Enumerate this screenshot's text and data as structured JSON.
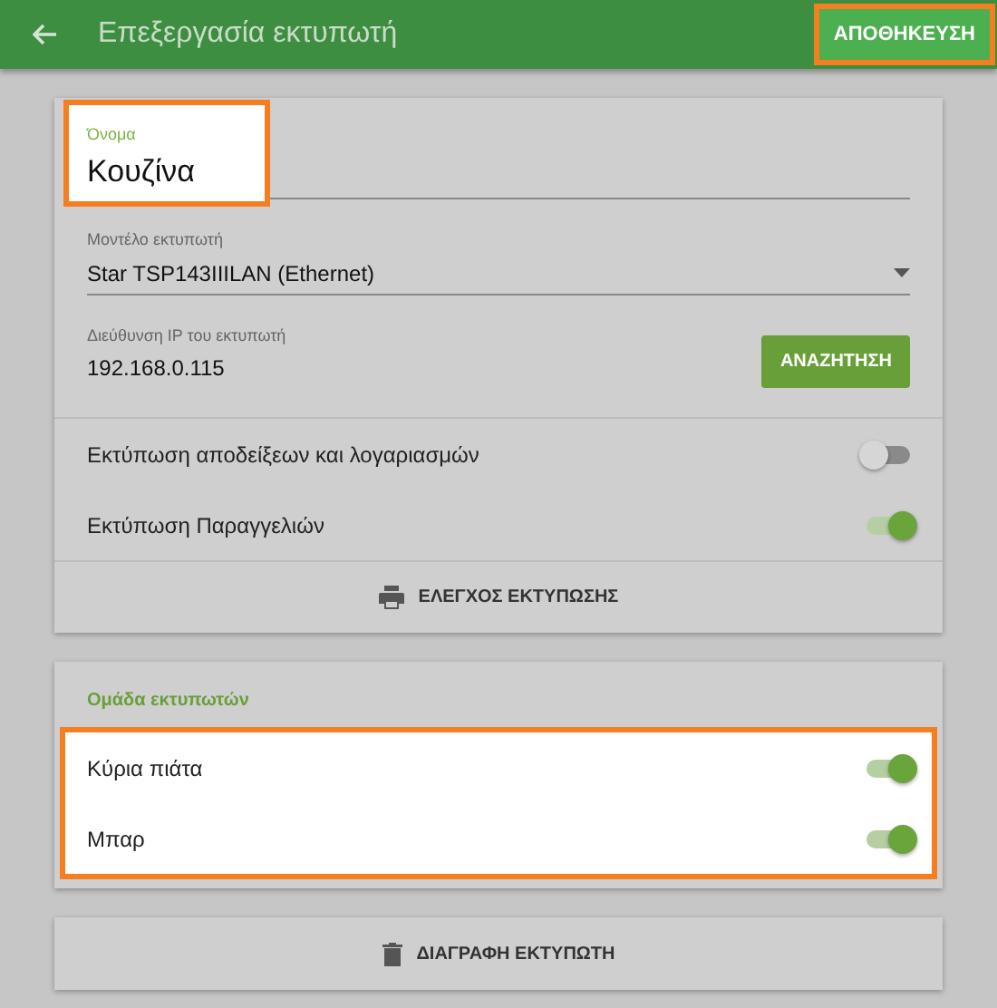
{
  "app_bar": {
    "title": "Επεξεργασία εκτυπωτή",
    "save": {
      "label": "ΑΠΟΘΗΚΕΥΣΗ",
      "highlighted": true
    }
  },
  "name_field": {
    "label": "Όνομα",
    "value": "Κουζίνα",
    "highlighted": true
  },
  "model_field": {
    "label": "Μοντέλο εκτυπωτή",
    "value": "Star TSP143IIILAN (Ethernet)"
  },
  "ip_field": {
    "label": "Διεύθυνση IP του εκτυπωτή",
    "value": "192.168.0.115"
  },
  "search_button": "ΑΝΑΖΗΤΗΣΗ",
  "toggles": [
    {
      "label": "Εκτύπωση αποδείξεων και λογαριασμών",
      "on": false
    },
    {
      "label": "Εκτύπωση Παραγγελιών",
      "on": true
    }
  ],
  "test_button": "ΕΛΕΓΧΟΣ ΕΚΤΥΠΩΣΗΣ",
  "printer_group": {
    "title": "Ομάδα εκτυπωτών",
    "highlighted": true,
    "items": [
      {
        "label": "Κύρια πιάτα",
        "on": true
      },
      {
        "label": "Μπαρ",
        "on": true
      }
    ]
  },
  "delete_button": "ΔΙΑΓΡΑΦΗ ΕΚΤΥΠΩΤΗ"
}
